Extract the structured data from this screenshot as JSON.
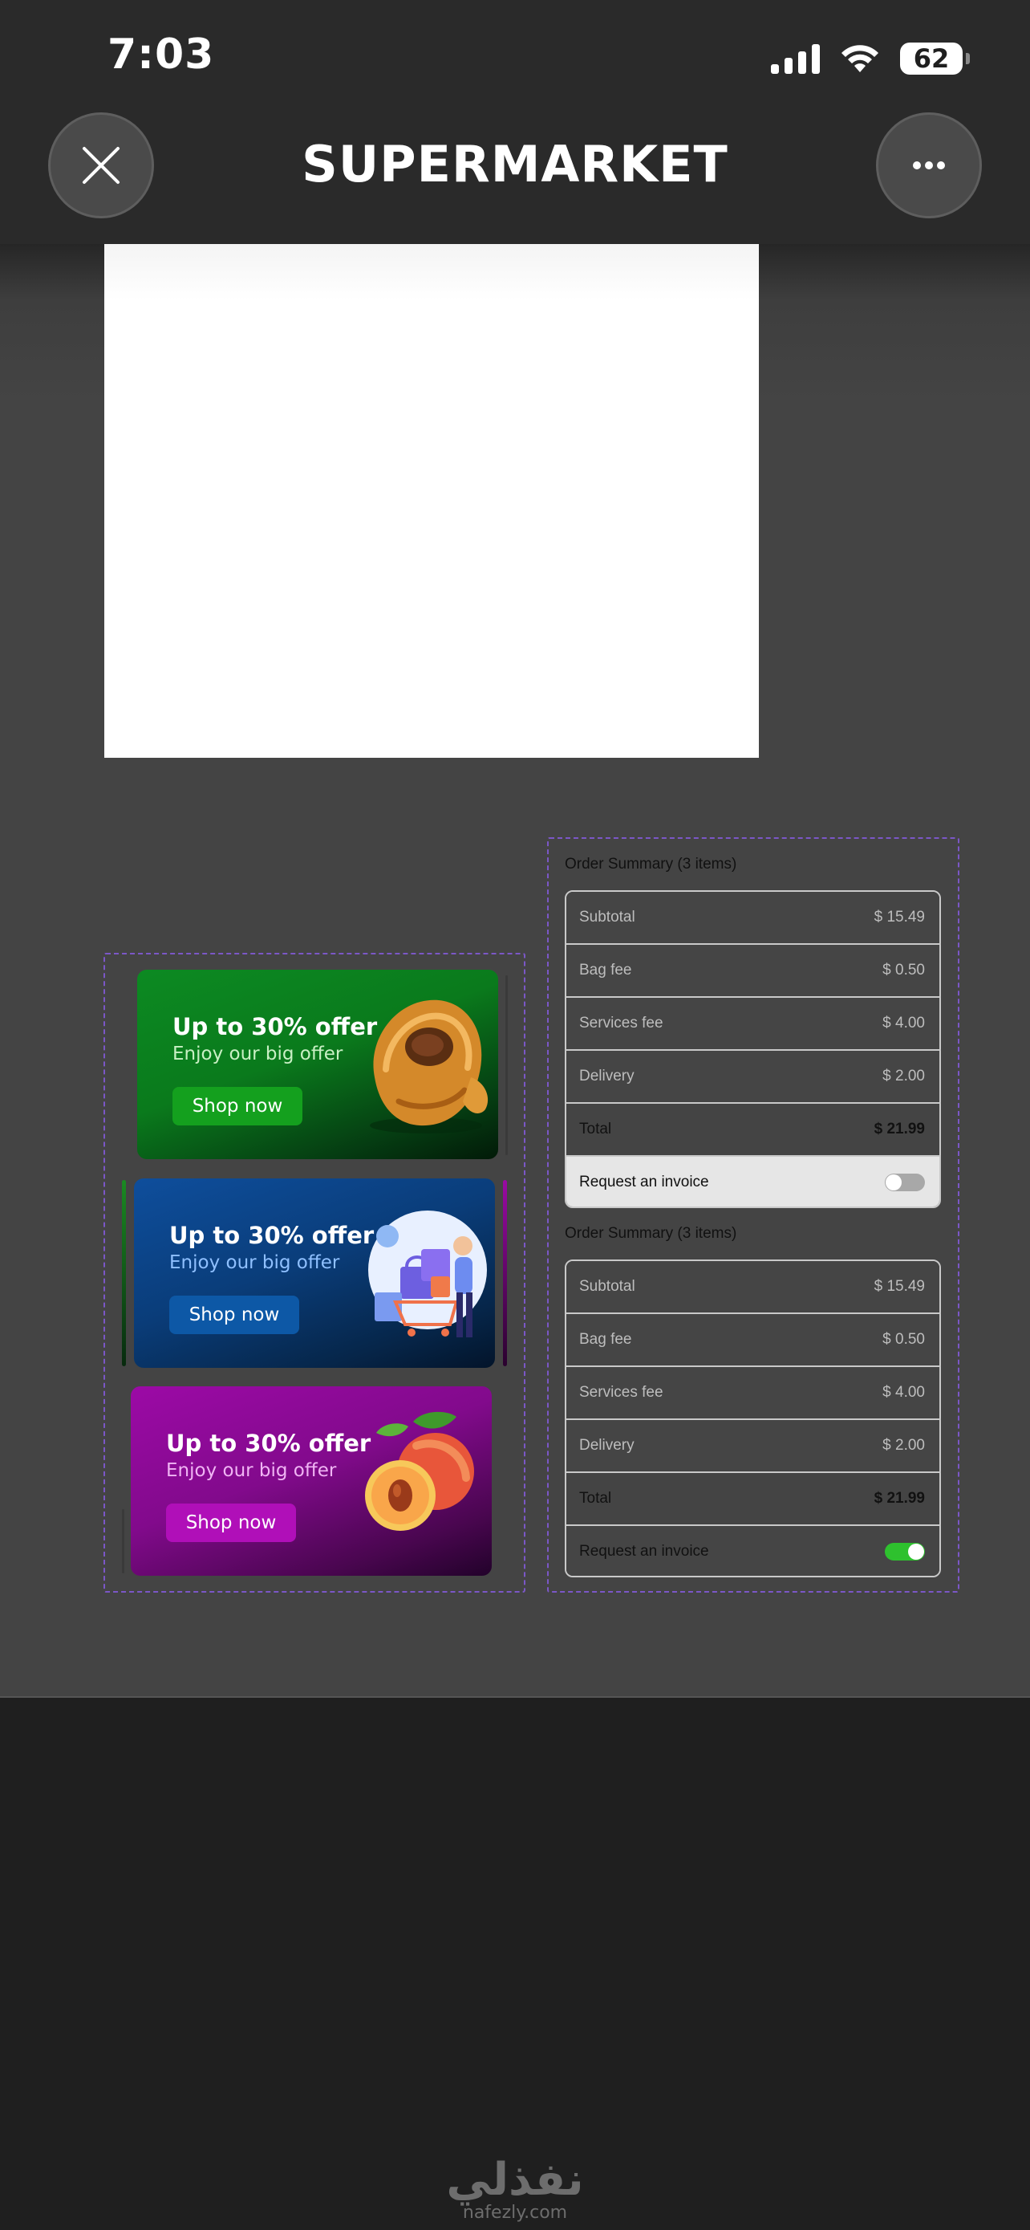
{
  "status_bar": {
    "time": "7:03",
    "battery_level": "62",
    "icons": [
      "cellular-signal-icon",
      "wifi-icon",
      "battery-icon"
    ]
  },
  "nav": {
    "title": "SUPERMARKET",
    "left_icon": "close-icon",
    "right_icon": "more-icon"
  },
  "banners": [
    {
      "title": "Up to 30% offer",
      "subtitle": "Enjoy our big offer",
      "button_label": "Shop now",
      "art": "croissant-icon",
      "accent": "#14a01e"
    },
    {
      "title": "Up to 30% offer",
      "subtitle": "Enjoy our big offer",
      "button_label": "Shop now",
      "art": "shopping-cart-icon",
      "accent": "#0d58a6"
    },
    {
      "title": "Up to 30% offer",
      "subtitle": "Enjoy our big offer",
      "button_label": "Shop now",
      "art": "peach-icon",
      "accent": "#b00fb8"
    }
  ],
  "order_summaries": [
    {
      "title": "Order Summary (3 items)",
      "rows": [
        {
          "label": "Subtotal",
          "value": "$ 15.49"
        },
        {
          "label": "Bag fee",
          "value": "$ 0.50"
        },
        {
          "label": "Services fee",
          "value": "$ 4.00"
        },
        {
          "label": "Delivery",
          "value": "$ 2.00"
        },
        {
          "label": "Total",
          "value": "$ 21.99"
        }
      ],
      "invoice_label": "Request an invoice",
      "invoice_toggle": "off"
    },
    {
      "title": "Order Summary (3 items)",
      "rows": [
        {
          "label": "Subtotal",
          "value": "$ 15.49"
        },
        {
          "label": "Bag fee",
          "value": "$ 0.50"
        },
        {
          "label": "Services fee",
          "value": "$ 4.00"
        },
        {
          "label": "Delivery",
          "value": "$ 2.00"
        },
        {
          "label": "Total",
          "value": "$ 21.99"
        }
      ],
      "invoice_label": "Request an invoice",
      "invoice_toggle": "on"
    }
  ],
  "watermark": {
    "arabic": "نفذلي",
    "latin": "nafezly.com"
  },
  "colors": {
    "selection_outline": "#7b57c7",
    "toggle_on": "#2ec12e"
  }
}
